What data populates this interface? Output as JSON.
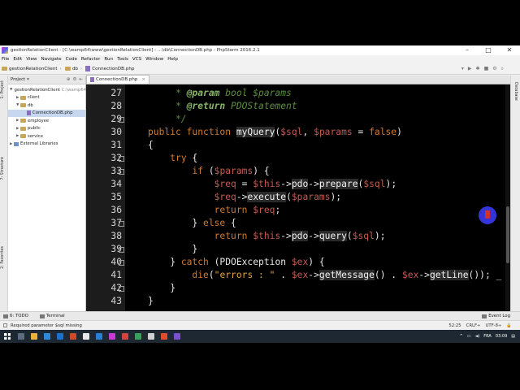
{
  "window": {
    "title": "gestionRelationClient - [C:\\wamp64\\www\\gestionRelationClient] - ...\\db\\ConnectionDB.php - PhpStorm 2016.2.1",
    "controls": [
      "–",
      "□",
      "✕"
    ]
  },
  "menu": [
    "File",
    "Edit",
    "View",
    "Navigate",
    "Code",
    "Refactor",
    "Run",
    "Tools",
    "VCS",
    "Window",
    "Help"
  ],
  "breadcrumbs": [
    "gestionRelationClient",
    "db",
    "ConnectionDB.php"
  ],
  "project_panel": {
    "header": "Project",
    "tree": [
      {
        "label": "gestionRelationClient",
        "extra": "C:\\wamp64\\",
        "type": "folder",
        "depth": 0,
        "expanded": true
      },
      {
        "label": "client",
        "type": "folder",
        "depth": 1,
        "expanded": false
      },
      {
        "label": "db",
        "type": "folder",
        "depth": 1,
        "expanded": true
      },
      {
        "label": "ConnectionDB.php",
        "type": "php",
        "depth": 2,
        "selected": true
      },
      {
        "label": "employee",
        "type": "folder",
        "depth": 1,
        "expanded": false
      },
      {
        "label": "public",
        "type": "folder",
        "depth": 1,
        "expanded": false
      },
      {
        "label": "service",
        "type": "folder",
        "depth": 1,
        "expanded": false
      },
      {
        "label": "External Libraries",
        "type": "lib",
        "depth": 0,
        "expanded": false
      }
    ]
  },
  "left_tool_tabs": [
    "1: Project",
    "7: Structure",
    "2: Favorites"
  ],
  "right_tool_tabs": [
    "Database"
  ],
  "editor": {
    "tab": "ConnectionDB.php",
    "lines": [
      {
        "n": "27",
        "fold": false,
        "tokens": [
          [
            "k-doc",
            "     * "
          ],
          [
            "k-tag",
            "@param"
          ],
          [
            "k-doc",
            " bool $params"
          ]
        ]
      },
      {
        "n": "28",
        "fold": false,
        "tokens": [
          [
            "k-doc",
            "     * "
          ],
          [
            "k-tag",
            "@return"
          ],
          [
            "k-doc",
            " PDOStatement"
          ]
        ]
      },
      {
        "n": "29",
        "fold": true,
        "tokens": [
          [
            "k-doc",
            "     */"
          ]
        ]
      },
      {
        "n": "30",
        "fold": false,
        "tokens": [
          [
            "k-kw",
            "public function "
          ],
          [
            "k-hl",
            "myQuery"
          ],
          [
            "k-plain",
            "("
          ],
          [
            "k-var",
            "$sql"
          ],
          [
            "k-plain",
            ", "
          ],
          [
            "k-var",
            "$params"
          ],
          [
            "k-plain",
            " = "
          ],
          [
            "k-kw",
            "false"
          ],
          [
            "k-plain",
            ")"
          ]
        ]
      },
      {
        "n": "31",
        "fold": false,
        "tokens": [
          [
            "k-plain",
            "{"
          ]
        ]
      },
      {
        "n": "32",
        "fold": true,
        "tokens": [
          [
            "k-plain",
            "    "
          ],
          [
            "k-kw",
            "try"
          ],
          [
            "k-plain",
            " {"
          ]
        ]
      },
      {
        "n": "33",
        "fold": true,
        "tokens": [
          [
            "k-plain",
            "        "
          ],
          [
            "k-kw",
            "if"
          ],
          [
            "k-plain",
            " ("
          ],
          [
            "k-var",
            "$params"
          ],
          [
            "k-plain",
            ") {"
          ]
        ]
      },
      {
        "n": "34",
        "fold": false,
        "tokens": [
          [
            "k-plain",
            "            "
          ],
          [
            "k-var",
            "$req"
          ],
          [
            "k-plain",
            " = "
          ],
          [
            "k-var",
            "$this"
          ],
          [
            "k-plain",
            "->"
          ],
          [
            "k-hl",
            "pdo"
          ],
          [
            "k-plain",
            "->"
          ],
          [
            "k-hl",
            "prepare"
          ],
          [
            "k-plain",
            "("
          ],
          [
            "k-var",
            "$sql"
          ],
          [
            "k-plain",
            ");"
          ]
        ]
      },
      {
        "n": "35",
        "fold": false,
        "tokens": [
          [
            "k-plain",
            "            "
          ],
          [
            "k-var",
            "$req"
          ],
          [
            "k-plain",
            "->"
          ],
          [
            "k-hl",
            "execute"
          ],
          [
            "k-plain",
            "("
          ],
          [
            "k-var",
            "$params"
          ],
          [
            "k-plain",
            ");"
          ]
        ]
      },
      {
        "n": "36",
        "fold": false,
        "tokens": [
          [
            "k-plain",
            "            "
          ],
          [
            "k-kw",
            "return "
          ],
          [
            "k-var",
            "$req"
          ],
          [
            "k-plain",
            ";"
          ]
        ]
      },
      {
        "n": "37",
        "fold": true,
        "tokens": [
          [
            "k-plain",
            "        } "
          ],
          [
            "k-kw",
            "else"
          ],
          [
            "k-plain",
            " {"
          ]
        ]
      },
      {
        "n": "38",
        "fold": false,
        "tokens": [
          [
            "k-plain",
            "            "
          ],
          [
            "k-kw",
            "return "
          ],
          [
            "k-var",
            "$this"
          ],
          [
            "k-plain",
            "->"
          ],
          [
            "k-hl",
            "pdo"
          ],
          [
            "k-plain",
            "->"
          ],
          [
            "k-hl",
            "query"
          ],
          [
            "k-plain",
            "("
          ],
          [
            "k-var",
            "$sql"
          ],
          [
            "k-plain",
            ");"
          ]
        ]
      },
      {
        "n": "39",
        "fold": true,
        "tokens": [
          [
            "k-plain",
            "        }"
          ]
        ]
      },
      {
        "n": "40",
        "fold": true,
        "tokens": [
          [
            "k-plain",
            "    } "
          ],
          [
            "k-kw",
            "catch"
          ],
          [
            "k-plain",
            " (PDOException "
          ],
          [
            "k-var",
            "$ex"
          ],
          [
            "k-plain",
            ") {"
          ]
        ]
      },
      {
        "n": "41",
        "fold": false,
        "tokens": [
          [
            "k-plain",
            "        "
          ],
          [
            "k-kw",
            "die"
          ],
          [
            "k-plain",
            "("
          ],
          [
            "k-str",
            "\"errors : \""
          ],
          [
            "k-plain",
            " . "
          ],
          [
            "k-var",
            "$ex"
          ],
          [
            "k-plain",
            "->"
          ],
          [
            "k-hl",
            "getMessage"
          ],
          [
            "k-plain",
            "() . "
          ],
          [
            "k-var",
            "$ex"
          ],
          [
            "k-plain",
            "->"
          ],
          [
            "k-hl",
            "getLine"
          ],
          [
            "k-plain",
            "()); _"
          ]
        ]
      },
      {
        "n": "42",
        "fold": true,
        "tokens": [
          [
            "k-plain",
            "    }"
          ]
        ]
      },
      {
        "n": "43",
        "fold": false,
        "tokens": [
          [
            "k-plain",
            "}"
          ]
        ]
      }
    ]
  },
  "bottom_tools": {
    "todo": "6: TODO",
    "terminal": "Terminal",
    "event_log": "Event Log"
  },
  "status": {
    "message": "Required parameter $sql missing",
    "position": "52:25",
    "line_sep": "CRLF÷",
    "encoding": "UTF-8÷"
  },
  "taskbar": {
    "lang": "FRA",
    "time": "03:09",
    "icon_colors": [
      "#5a6c7e",
      "#e7b23a",
      "#2e8ad8",
      "#1e6fd0",
      "#d04a2a",
      "#e8e8e8",
      "#2a7ed6",
      "#c93ad3",
      "#d44343",
      "#3aa057",
      "#d0d0d0",
      "#e24c2c",
      "#7a4fd0"
    ]
  }
}
